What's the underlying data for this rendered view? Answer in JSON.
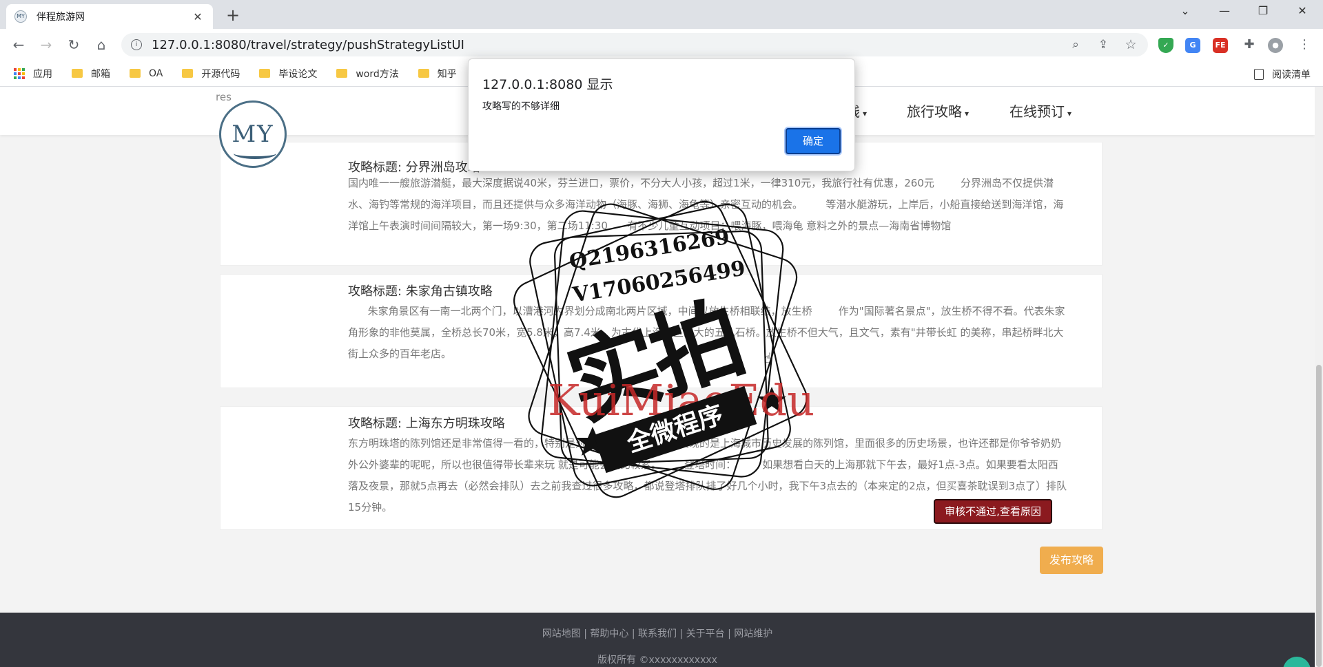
{
  "browser": {
    "tab_title": "伴程旅游网",
    "favicon_text": "MY",
    "url": "127.0.0.1:8080/travel/strategy/pushStrategyListUI",
    "bookmarks": [
      "应用",
      "邮箱",
      "OA",
      "开源代码",
      "毕设论文",
      "word方法",
      "知乎"
    ],
    "reader_label": "阅读清单"
  },
  "site": {
    "logo_alt": "res",
    "logo_text": "MY",
    "nav": [
      {
        "label": "线"
      },
      {
        "label": "旅行攻略"
      },
      {
        "label": "在线预订"
      }
    ]
  },
  "strategies": [
    {
      "title": "攻略标题: 分界洲岛攻略",
      "body": "国内唯一一艘旅游潜艇，最大深度据说40米，芬兰进口，票价，不分大人小孩，超过1米，一律310元，我旅行社有优惠，260元        分界洲岛不仅提供潜水、海钓等常规的海洋项目，而且还提供与众多海洋动物（海豚、海狮、海龟等）亲密互动的机会。       等潜水艇游玩，上岸后，小船直接给送到海洋馆，海洋馆上午表演时间间隔较大，第一场9:30，第二场11:30      有不少儿童互动项目：喂海豚，喂海龟 意料之外的景点—海南省博物馆"
    },
    {
      "title": "攻略标题: 朱家角古镇攻略",
      "body": "      朱家角景区有一南一北两个门，以漕港河为界划分成南北两片区域，中间以放生桥相联结，放生桥        作为\"国际著名景点\"，放生桥不得不看。代表朱家角形象的非他莫属，全桥总长70米，宽5.8米，高7.4米，为古代上海地区最大的五孔石桥。放生桥不但大气，且文气，素有\"井带长虹 的美称，串起桥畔北大街上众多的百年老店。"
    },
    {
      "title": "攻略标题: 上海东方明珠攻略",
      "body": "东方明珠塔的陈列馆还是非常值得一看的，特别是对于上海人来说，里面展现的是上海城市历史发展的陈列馆，里面很多的历史场景，也许还都是你爷爷奶奶外公外婆辈的呢呢，所以也很值得带长辈来玩 就是可能会走比较累。       登塔时间：        如果想看白天的上海那就下午去，最好1点-3点。如果要看太阳西落及夜景，那就5点再去（必然会排队）去之前我查过很多攻略，都说登塔排队排了好几个小时，我下午3点去的（本来定的2点，但买喜茶耽误到3点了）排队15分钟。",
      "status_button": "审核不通过,查看原因"
    }
  ],
  "publish_button": "发布攻略",
  "footer": {
    "links": "网站地图 | 帮助中心 | 联系我们 | 关于平台 | 网站维护",
    "copyright": "版权所有 ©xxxxxxxxxxxx"
  },
  "alert": {
    "title": "127.0.0.1:8080 显示",
    "message": "攻略写的不够详细",
    "ok_label": "确定"
  },
  "watermark": {
    "contact1": "Q2196316269",
    "contact2": "V17060256499",
    "big_text": "实拍",
    "red_text": "KuiMiaoEdu",
    "ribbon_text": "全微程序"
  }
}
